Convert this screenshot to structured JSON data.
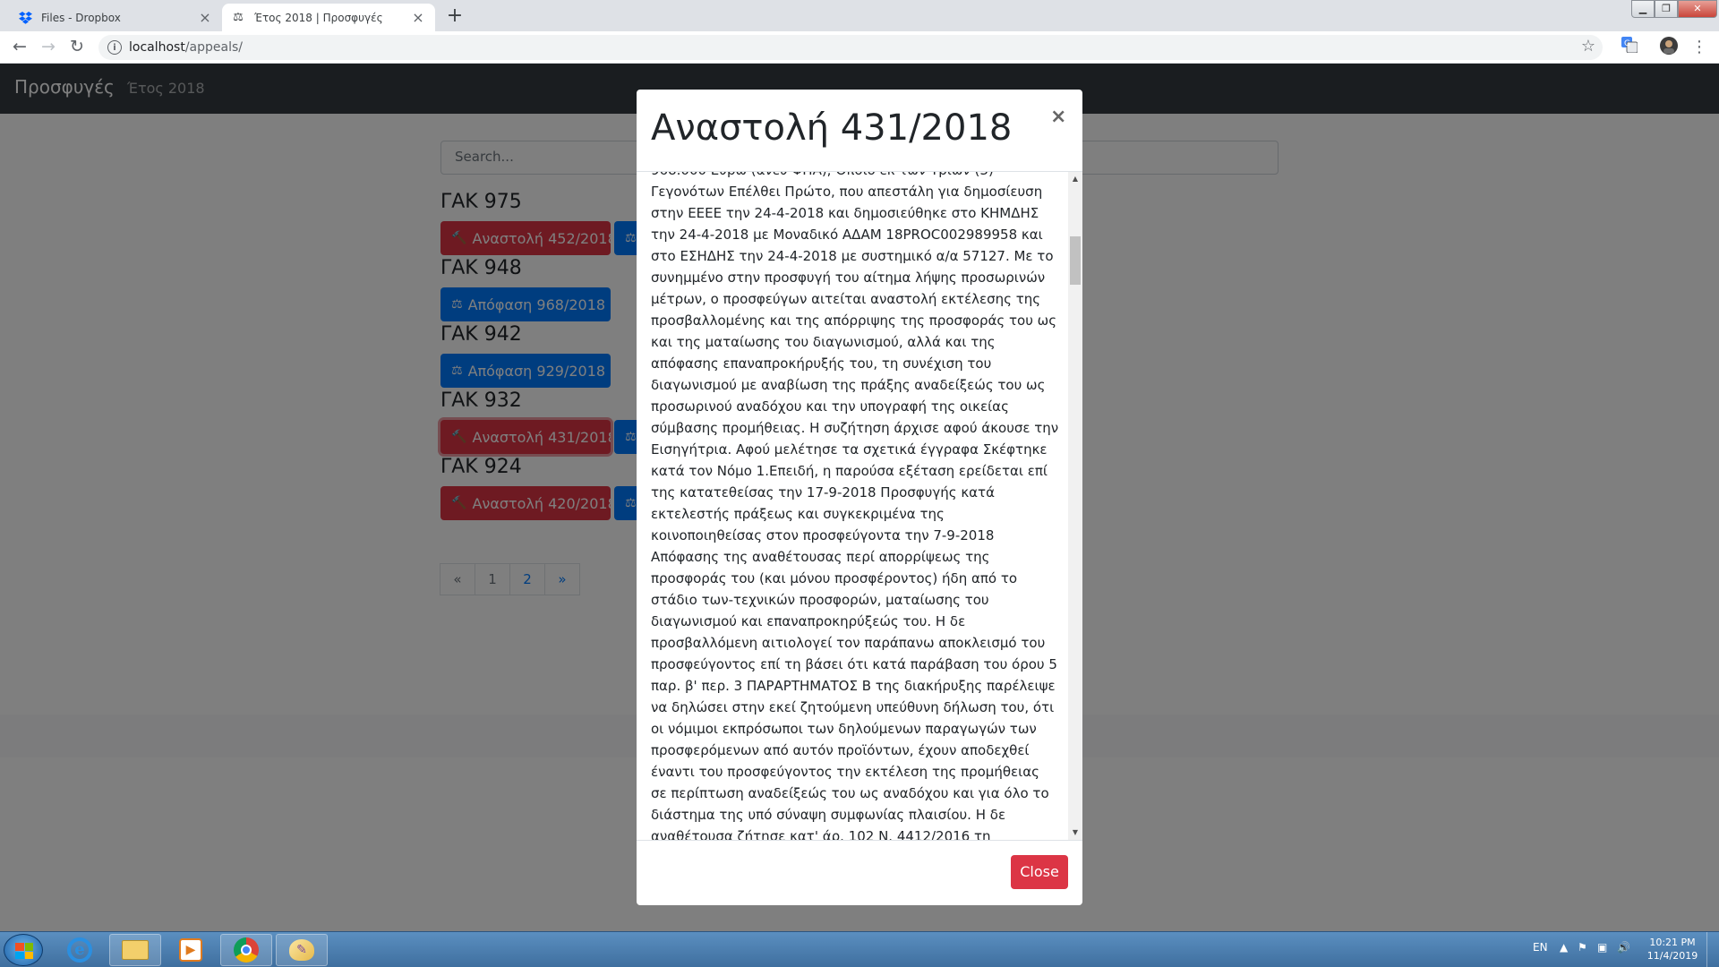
{
  "browser": {
    "tabs": [
      {
        "title": "Files - Dropbox",
        "icon": "dropbox-icon",
        "active": false
      },
      {
        "title": "Έτος 2018 | Προσφυγές",
        "icon": "scales-icon",
        "active": true
      }
    ],
    "url": {
      "host": "localhost",
      "path": "/appeals/"
    }
  },
  "nav": {
    "brand": "Προσφυγές",
    "link": "Έτος 2018"
  },
  "search": {
    "placeholder": "Search..."
  },
  "groups": [
    {
      "title": "ΓΑΚ 975",
      "buttons": [
        {
          "label": "Αναστολή 452/2018",
          "icon": "gavel-icon",
          "color": "#dc3545"
        }
      ]
    },
    {
      "title": "ΓΑΚ 948",
      "buttons": [
        {
          "label": "Απόφαση 968/2018",
          "icon": "scales-icon",
          "color": "#007bff"
        }
      ]
    },
    {
      "title": "ΓΑΚ 942",
      "buttons": [
        {
          "label": "Απόφαση 929/2018",
          "icon": "scales-icon",
          "color": "#007bff"
        }
      ]
    },
    {
      "title": "ΓΑΚ 932",
      "buttons": [
        {
          "label": "Αναστολή 431/2018",
          "icon": "gavel-icon",
          "color": "#dc3545"
        }
      ]
    },
    {
      "title": "ΓΑΚ 924",
      "buttons": [
        {
          "label": "Αναστολή 420/2018",
          "icon": "gavel-icon",
          "color": "#dc3545"
        }
      ]
    }
  ],
  "pagination": {
    "prev": "«",
    "pages": [
      "1",
      "2"
    ],
    "next": "»"
  },
  "modal": {
    "title": "Αναστολή 431/2018",
    "close_x": "×",
    "close_label": "Close",
    "body": "968.000 Ευρώ (άνευ ΦΠΑ), Όποιο εκ των Τριών (3) Γεγονότων Επέλθει Πρώτο, που απεστάλη για δημοσίευση στην ΕΕΕΕ την 24-4-2018 και δημοσιεύθηκε στο ΚΗΜΔΗΣ την 24-4-2018 με Μοναδικό ΑΔΑΜ 18PROC002989958 και στο ΕΣΗΔΗΣ την 24-4-2018 με συστημικό α/α 57127. Με το συνημμένο στην προσφυγή του αίτημα λήψης προσωρινών μέτρων, ο προσφεύγων αιτείται αναστολή εκτέλεσης της προσβαλλομένης και της απόρριψης της προσφοράς του ως και της ματαίωσης του διαγωνισμού, αλλά και της απόφασης επαναπροκήρυξής του, τη συνέχιση του διαγωνισμού με αναβίωση της πράξης αναδείξεώς του ως προσωρινού αναδόχου και την υπογραφή της οικείας σύμβασης προμήθειας. Η συζήτηση άρχισε αφού άκουσε την Εισηγήτρια. Αφού μελέτησε τα σχετικά έγγραφα Σκέφτηκε κατά τον Νόμο 1.Επειδή, η παρούσα εξέταση ερείδεται επί της κατατεθείσας την 17-9-2018 Προσφυγής κατά εκτελεστής πράξεως και συγκεκριμένα της κοινοποιηθείσας στον προσφεύγοντα την 7-9-2018 Απόφασης της αναθέτουσας περί απορρίψεως της προσφοράς του (και μόνου προσφέροντος) ήδη από το στάδιο των-τεχνικών προσφορών, ματαίωσης του διαγωνισμού και επαναπροκηρύξεώς του. Η δε προσβαλλόμενη αιτιολογεί τον παράπανω αποκλεισμό του προσφεύγοντος επί τη βάσει ότι κατά παράβαση του όρου 5 παρ. β' περ. 3 ΠΑΡΑΡΤΗΜΑΤΟΣ Β της διακήρυξης παρέλειψε να δηλώσει στην εκεί ζητούμενη υπεύθυνη δήλωση του, ότι οι νόμιμοι εκπρόσωποι των δηλούμενων παραγωγών των προσφερόμενων από αυτόν προϊόντων, έχουν αποδεχθεί έναντι του προσφεύγοντος την εκτέλεση της προμήθειας σε περίπτωση αναδείξεώς του ως αναδόχου και για όλο το διάστημα της υπό σύναψη συμφωνίας πλαισίου. Η δε αναθέτουσα ζήτησε κατ' άρ. 102 Ν. 4412/2016 τη"
  },
  "taskbar": {
    "apps": [
      "start-button",
      "internet-explorer-icon",
      "file-explorer-icon",
      "media-player-icon",
      "chrome-icon",
      "paint-icon"
    ],
    "lang": "EN",
    "time": "10:21 PM",
    "date": "11/4/2019"
  }
}
